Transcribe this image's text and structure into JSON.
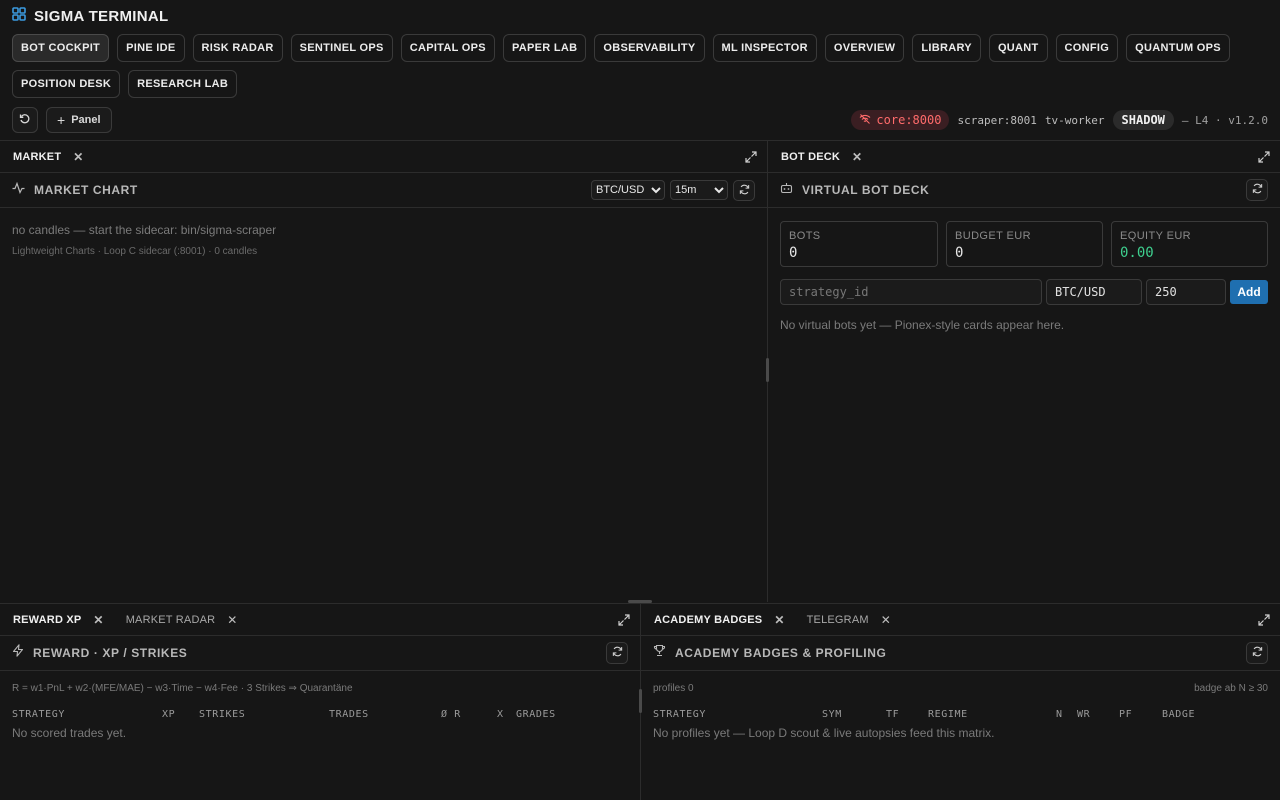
{
  "app": {
    "title": "SIGMA TERMINAL"
  },
  "nav": {
    "tabs": [
      "BOT COCKPIT",
      "PINE IDE",
      "RISK RADAR",
      "SENTINEL OPS",
      "CAPITAL OPS",
      "PAPER LAB",
      "OBSERVABILITY",
      "ML INSPECTOR",
      "OVERVIEW",
      "LIBRARY",
      "QUANT",
      "CONFIG",
      "QUANTUM OPS",
      "POSITION DESK",
      "RESEARCH LAB"
    ],
    "active": "BOT COCKPIT"
  },
  "toolbar": {
    "panel_label": "Panel"
  },
  "status": {
    "core": "core:8000",
    "scraper": "scraper:8001",
    "worker": "tv-worker",
    "mode": "SHADOW",
    "version": "— L4 · v1.2.0",
    "core_color": "#ff6b6b"
  },
  "market": {
    "tab": "MARKET",
    "header": "MARKET CHART",
    "symbol": "BTC/USD",
    "interval": "15m",
    "empty": "no candles — start the sidecar: bin/sigma-scraper",
    "footer": "Lightweight Charts · Loop C sidecar (:8001) · 0 candles"
  },
  "botdeck": {
    "tab": "BOT DECK",
    "header": "VIRTUAL BOT DECK",
    "stats": [
      {
        "label": "BOTS",
        "value": "0"
      },
      {
        "label": "BUDGET EUR",
        "value": "0"
      },
      {
        "label": "EQUITY EUR",
        "value": "0.00"
      }
    ],
    "strategy_placeholder": "strategy_id",
    "symbol_value": "BTC/USD",
    "amount_value": "250",
    "add_label": "Add",
    "empty": "No virtual bots yet — Pionex-style cards appear here.",
    "equity_color": "#3ecf8e",
    "add_color": "#1f6fb0"
  },
  "reward": {
    "tabs": [
      "REWARD XP",
      "MARKET RADAR"
    ],
    "header": "REWARD · XP / STRIKES",
    "formula": "R = w1·PnL + w2·(MFE/MAE) − w3·Time − w4·Fee · 3 Strikes ⇒ Quarantäne",
    "columns": [
      "STRATEGY",
      "XP",
      "STRIKES",
      "TRADES",
      "Ø R",
      "X",
      "GRADES"
    ],
    "empty": "No scored trades yet."
  },
  "academy": {
    "tabs": [
      "ACADEMY BADGES",
      "TELEGRAM"
    ],
    "header": "ACADEMY BADGES & PROFILING",
    "profiles": "profiles 0",
    "badge_note": "badge ab N ≥ 30",
    "columns": [
      "STRATEGY",
      "SYM",
      "TF",
      "REGIME",
      "N",
      "WR",
      "PF",
      "BADGE"
    ],
    "empty": "No profiles yet — Loop D scout & live autopsies feed this matrix."
  }
}
